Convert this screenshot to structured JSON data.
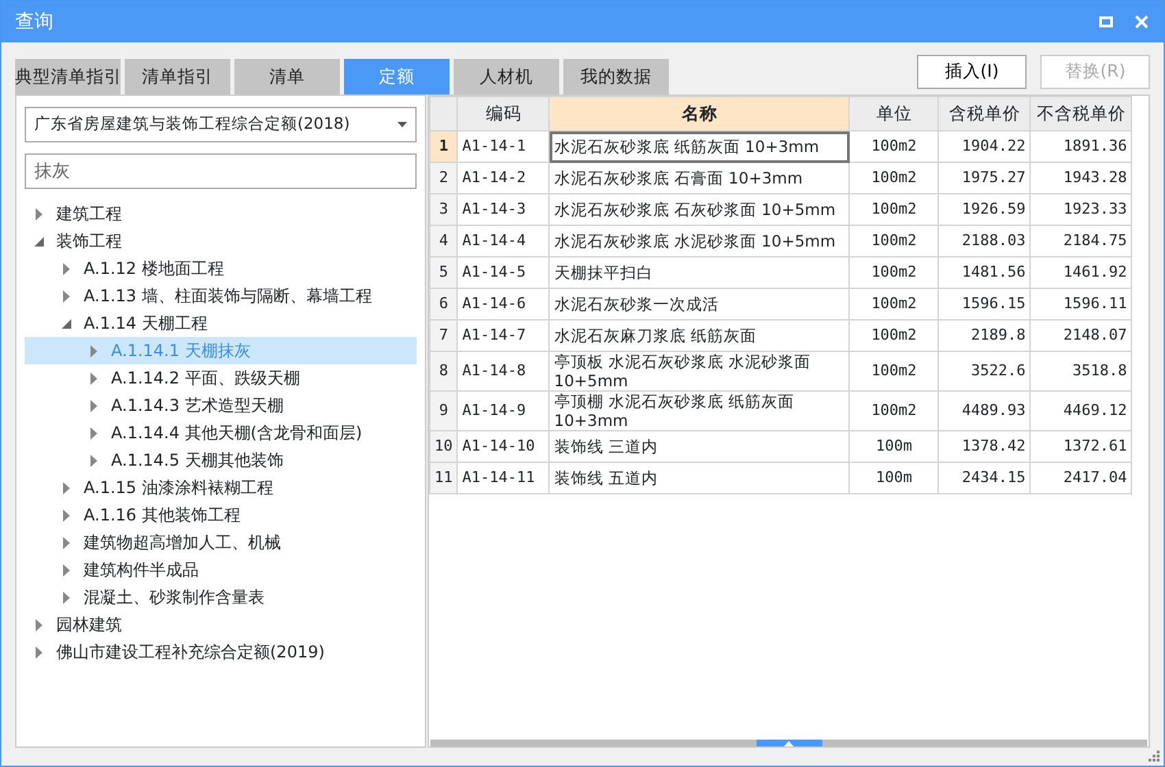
{
  "window": {
    "title": "查询"
  },
  "tabs": [
    {
      "label": "典型清单指引",
      "selected": false
    },
    {
      "label": "清单指引",
      "selected": false
    },
    {
      "label": "清单",
      "selected": false
    },
    {
      "label": "定额",
      "selected": true
    },
    {
      "label": "人材机",
      "selected": false
    },
    {
      "label": "我的数据",
      "selected": false
    }
  ],
  "buttons": [
    {
      "label": "插入(I)",
      "disabled": false
    },
    {
      "label": "替换(R)",
      "disabled": true
    }
  ],
  "library_select": {
    "value": "广东省房屋建筑与装饰工程综合定额(2018)"
  },
  "search": {
    "value": "抹灰"
  },
  "tree": [
    {
      "label": "建筑工程",
      "expanded": false,
      "selected": false
    },
    {
      "label": "装饰工程",
      "expanded": true,
      "selected": false,
      "children": [
        {
          "label": "A.1.12 楼地面工程",
          "expanded": false,
          "selected": false
        },
        {
          "label": "A.1.13 墙、柱面装饰与隔断、幕墙工程",
          "expanded": false,
          "selected": false
        },
        {
          "label": "A.1.14 天棚工程",
          "expanded": true,
          "selected": false,
          "children": [
            {
              "label": "A.1.14.1 天棚抹灰",
              "expanded": false,
              "selected": true
            },
            {
              "label": "A.1.14.2 平面、跌级天棚",
              "expanded": false,
              "selected": false
            },
            {
              "label": "A.1.14.3 艺术造型天棚",
              "expanded": false,
              "selected": false
            },
            {
              "label": "A.1.14.4 其他天棚(含龙骨和面层)",
              "expanded": false,
              "selected": false
            },
            {
              "label": "A.1.14.5 天棚其他装饰",
              "expanded": false,
              "selected": false
            }
          ]
        },
        {
          "label": "A.1.15 油漆涂料裱糊工程",
          "expanded": false,
          "selected": false
        },
        {
          "label": "A.1.16 其他装饰工程",
          "expanded": false,
          "selected": false
        },
        {
          "label": "建筑物超高增加人工、机械",
          "expanded": false,
          "selected": false
        },
        {
          "label": "建筑构件半成品",
          "expanded": false,
          "selected": false
        },
        {
          "label": "混凝土、砂浆制作含量表",
          "expanded": false,
          "selected": false
        }
      ]
    },
    {
      "label": "园林建筑",
      "expanded": false,
      "selected": false
    },
    {
      "label": "佛山市建设工程补充综合定额(2019)",
      "expanded": false,
      "selected": false
    }
  ],
  "table": {
    "columns": [
      {
        "label": "编码",
        "selected": false
      },
      {
        "label": "名称",
        "selected": true
      },
      {
        "label": "单位",
        "selected": false
      },
      {
        "label": "含税单价",
        "selected": false
      },
      {
        "label": "不含税单价",
        "selected": false
      }
    ],
    "rows": [
      {
        "number": "1",
        "code": "A1-14-1",
        "name": "水泥石灰砂浆底 纸筋灰面 10+3mm",
        "unit": "100m2",
        "tax_price": "1904.22",
        "price": "1891.36",
        "selected": true
      },
      {
        "number": "2",
        "code": "A1-14-2",
        "name": "水泥石灰砂浆底 石膏面 10+3mm",
        "unit": "100m2",
        "tax_price": "1975.27",
        "price": "1943.28",
        "selected": false
      },
      {
        "number": "3",
        "code": "A1-14-3",
        "name": "水泥石灰砂浆底 石灰砂浆面 10+5mm",
        "unit": "100m2",
        "tax_price": "1926.59",
        "price": "1923.33",
        "selected": false
      },
      {
        "number": "4",
        "code": "A1-14-4",
        "name": "水泥石灰砂浆底 水泥砂浆面 10+5mm",
        "unit": "100m2",
        "tax_price": "2188.03",
        "price": "2184.75",
        "selected": false
      },
      {
        "number": "5",
        "code": "A1-14-5",
        "name": "天棚抹平扫白",
        "unit": "100m2",
        "tax_price": "1481.56",
        "price": "1461.92",
        "selected": false
      },
      {
        "number": "6",
        "code": "A1-14-6",
        "name": "水泥石灰砂浆一次成活",
        "unit": "100m2",
        "tax_price": "1596.15",
        "price": "1596.11",
        "selected": false
      },
      {
        "number": "7",
        "code": "A1-14-7",
        "name": "水泥石灰麻刀浆底 纸筋灰面",
        "unit": "100m2",
        "tax_price": "2189.8",
        "price": "2148.07",
        "selected": false
      },
      {
        "number": "8",
        "code": "A1-14-8",
        "name": "亭顶板 水泥石灰砂浆底 水泥砂浆面 10+5mm",
        "unit": "100m2",
        "tax_price": "3522.6",
        "price": "3518.8",
        "selected": false
      },
      {
        "number": "9",
        "code": "A1-14-9",
        "name": "亭顶棚 水泥石灰砂浆底 纸筋灰面 10+3mm",
        "unit": "100m2",
        "tax_price": "4489.93",
        "price": "4469.12",
        "selected": false
      },
      {
        "number": "10",
        "code": "A1-14-10",
        "name": "装饰线 三道内",
        "unit": "100m",
        "tax_price": "1378.42",
        "price": "1372.61",
        "selected": false
      },
      {
        "number": "11",
        "code": "A1-14-11",
        "name": "装饰线 五道内",
        "unit": "100m",
        "tax_price": "2434.15",
        "price": "2417.04",
        "selected": false
      }
    ]
  }
}
